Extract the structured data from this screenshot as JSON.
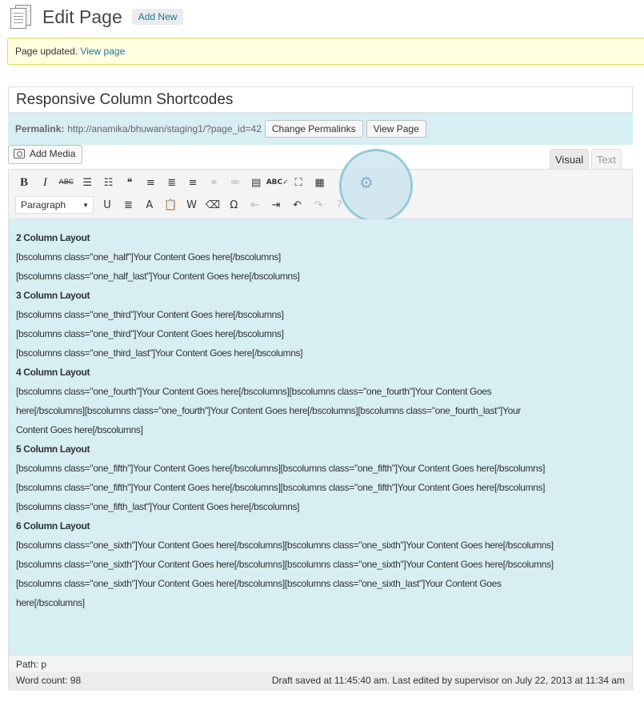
{
  "header": {
    "title": "Edit Page",
    "add_new": "Add New"
  },
  "notice": {
    "text": "Page updated.",
    "link": "View page"
  },
  "post_title": "Responsive Column Shortcodes",
  "permalink": {
    "label": "Permalink:",
    "url": "http://anamika/bhuwan/staging1/?page_id=42",
    "change_button": "Change Permalinks",
    "view_button": "View Page"
  },
  "media": {
    "add_media": "Add Media"
  },
  "tabs": {
    "visual": "Visual",
    "text": "Text"
  },
  "toolbar": {
    "row1": [
      {
        "glyph": "B",
        "name": "bold-button"
      },
      {
        "glyph": "I",
        "name": "italic-button"
      },
      {
        "glyph": "ABC",
        "name": "strikethrough-button"
      },
      {
        "glyph": "☰",
        "name": "bullet-list-button"
      },
      {
        "glyph": "☷",
        "name": "numbered-list-button"
      },
      {
        "glyph": "❝",
        "name": "blockquote-button"
      },
      {
        "glyph": "≡",
        "name": "align-left-button"
      },
      {
        "glyph": "≣",
        "name": "align-center-button"
      },
      {
        "glyph": "≡",
        "name": "align-right-button"
      },
      {
        "glyph": "⚭",
        "name": "insert-link-button"
      },
      {
        "glyph": "⚮",
        "name": "unlink-button"
      },
      {
        "glyph": "▤",
        "name": "insert-more-button"
      },
      {
        "glyph": "ABC✓",
        "name": "spellcheck-button"
      },
      {
        "glyph": "⛶",
        "name": "fullscreen-button"
      },
      {
        "glyph": "▦",
        "name": "kitchen-sink-button"
      }
    ],
    "format_select": "Paragraph",
    "row2": [
      {
        "glyph": "U",
        "name": "underline-button"
      },
      {
        "glyph": "≣",
        "name": "justify-button"
      },
      {
        "glyph": "A",
        "name": "text-color-button"
      },
      {
        "glyph": "📋",
        "name": "paste-text-button"
      },
      {
        "glyph": "W",
        "name": "paste-word-button"
      },
      {
        "glyph": "⌫",
        "name": "clear-formatting-button"
      },
      {
        "glyph": "Ω",
        "name": "special-character-button"
      },
      {
        "glyph": "⇤",
        "name": "outdent-button"
      },
      {
        "glyph": "⇥",
        "name": "indent-button"
      },
      {
        "glyph": "↶",
        "name": "undo-button"
      },
      {
        "glyph": "↷",
        "name": "redo-button"
      },
      {
        "glyph": "?",
        "name": "help-button"
      }
    ]
  },
  "content_lines": [
    {
      "text": "2 Column Layout",
      "heading": true
    },
    {
      "text": "[bscolumns class=\"one_half\"]Your Content Goes here[/bscolumns]",
      "heading": false
    },
    {
      "text": "[bscolumns class=\"one_half_last\"]Your Content Goes here[/bscolumns]",
      "heading": false
    },
    {
      "text": "3 Column Layout",
      "heading": true
    },
    {
      "text": "[bscolumns class=\"one_third\"]Your Content Goes here[/bscolumns]",
      "heading": false
    },
    {
      "text": "[bscolumns class=\"one_third\"]Your Content Goes here[/bscolumns]",
      "heading": false
    },
    {
      "text": "[bscolumns class=\"one_third_last\"]Your Content Goes here[/bscolumns]",
      "heading": false
    },
    {
      "text": "4 Column Layout",
      "heading": true
    },
    {
      "text": "[bscolumns class=\"one_fourth\"]Your Content Goes here[/bscolumns][bscolumns class=\"one_fourth\"]Your Content Goes",
      "heading": false
    },
    {
      "text": "here[/bscolumns][bscolumns class=\"one_fourth\"]Your Content Goes here[/bscolumns][bscolumns class=\"one_fourth_last\"]Your",
      "heading": false
    },
    {
      "text": "Content Goes here[/bscolumns]",
      "heading": false
    },
    {
      "text": "5 Column Layout",
      "heading": true
    },
    {
      "text": "[bscolumns class=\"one_fifth\"]Your Content Goes here[/bscolumns][bscolumns class=\"one_fifth\"]Your Content Goes here[/bscolumns]",
      "heading": false
    },
    {
      "text": "[bscolumns class=\"one_fifth\"]Your Content Goes here[/bscolumns][bscolumns class=\"one_fifth\"]Your Content Goes here[/bscolumns]",
      "heading": false
    },
    {
      "text": "[bscolumns class=\"one_fifth_last\"]Your Content Goes here[/bscolumns]",
      "heading": false
    },
    {
      "text": "6 Column Layout",
      "heading": true
    },
    {
      "text": "[bscolumns class=\"one_sixth\"]Your Content Goes here[/bscolumns][bscolumns class=\"one_sixth\"]Your Content Goes here[/bscolumns]",
      "heading": false
    },
    {
      "text": "[bscolumns class=\"one_sixth\"]Your Content Goes here[/bscolumns][bscolumns class=\"one_sixth\"]Your Content Goes here[/bscolumns]",
      "heading": false
    },
    {
      "text": "[bscolumns class=\"one_sixth\"]Your Content Goes here[/bscolumns][bscolumns class=\"one_sixth_last\"]Your Content Goes",
      "heading": false
    },
    {
      "text": "here[/bscolumns]",
      "heading": false
    }
  ],
  "path": "Path: p",
  "word_count": "Word count: 98",
  "draft_status": "Draft saved at 11:45:40 am. Last edited by supervisor on July 22, 2013 at 11:34 am"
}
